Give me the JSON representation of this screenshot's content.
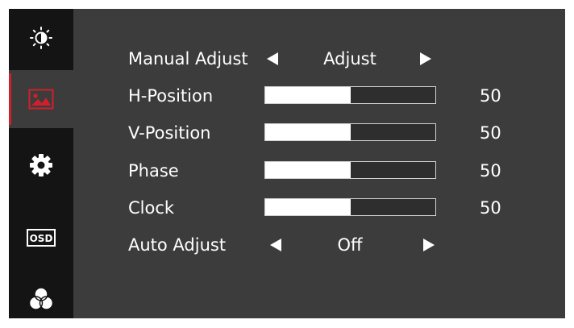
{
  "sidebar": {
    "items": [
      {
        "icon": "brightness-contrast-icon",
        "active": false
      },
      {
        "icon": "image-icon",
        "active": true
      },
      {
        "icon": "gear-icon",
        "active": false
      },
      {
        "icon": "osd-icon",
        "label": "OSD",
        "active": false
      },
      {
        "icon": "color-circles-icon",
        "active": false
      }
    ],
    "accent_color": "#d11f2b"
  },
  "menu": {
    "manual_adjust": {
      "label": "Manual Adjust",
      "value": "Adjust"
    },
    "h_position": {
      "label": "H-Position",
      "value": "50",
      "level": 50
    },
    "v_position": {
      "label": "V-Position",
      "value": "50",
      "level": 50
    },
    "phase": {
      "label": "Phase",
      "value": "50",
      "level": 50
    },
    "clock": {
      "label": "Clock",
      "value": "50",
      "level": 50
    },
    "auto_adjust": {
      "label": "Auto Adjust",
      "value": "Off"
    }
  }
}
